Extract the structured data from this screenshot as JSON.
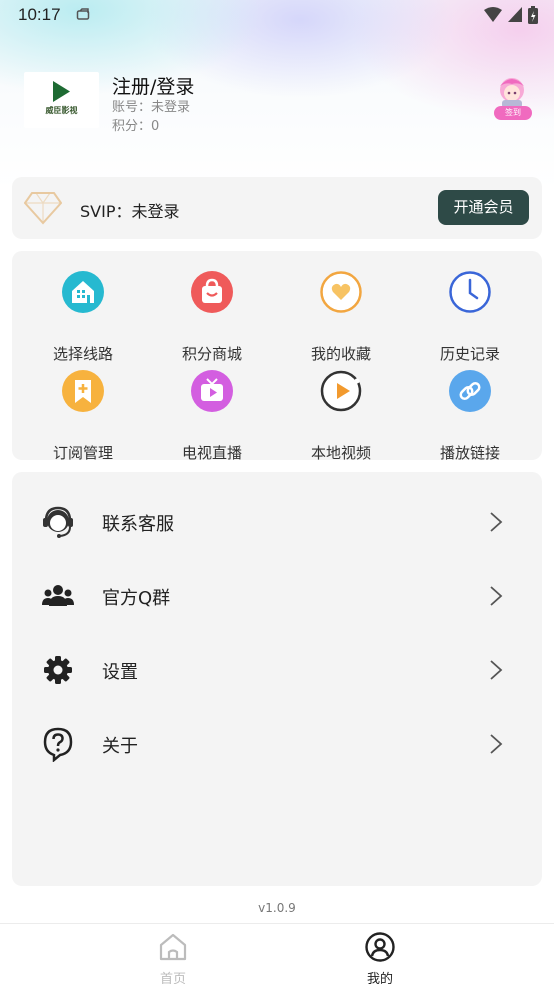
{
  "status_bar": {
    "time": "10:17"
  },
  "profile": {
    "logo_text": "威臣影视",
    "name": "注册/登录",
    "account": "账号：未登录",
    "points": "积分：0",
    "sign_label": "签到"
  },
  "svip": {
    "text": "SVIP：未登录",
    "button": "开通会员"
  },
  "grid": {
    "items": [
      {
        "label": "选择线路",
        "icon": "route-icon",
        "color": "#26b9d0"
      },
      {
        "label": "积分商城",
        "icon": "shop-bag-icon",
        "color": "#ef5a5a"
      },
      {
        "label": "我的收藏",
        "icon": "heart-icon",
        "color": "#f2a640"
      },
      {
        "label": "历史记录",
        "icon": "clock-icon",
        "color": "#3a66d8"
      },
      {
        "label": "订阅管理",
        "icon": "bookmark-plus-icon",
        "color": "#f7b23e"
      },
      {
        "label": "电视直播",
        "icon": "tv-icon",
        "color": "#d35ee0"
      },
      {
        "label": "本地视频",
        "icon": "play-circle-icon",
        "color": "#f29a2e"
      },
      {
        "label": "播放链接",
        "icon": "link-icon",
        "color": "#5aa7ec"
      }
    ]
  },
  "menu": {
    "items": [
      {
        "label": "联系客服",
        "icon": "headset-icon"
      },
      {
        "label": "官方Q群",
        "icon": "group-icon"
      },
      {
        "label": "设置",
        "icon": "gear-icon"
      },
      {
        "label": "关于",
        "icon": "question-icon"
      }
    ]
  },
  "version": "v1.0.9",
  "bottom_nav": {
    "items": [
      {
        "label": "首页",
        "icon": "home-icon",
        "active": false
      },
      {
        "label": "我的",
        "icon": "profile-icon",
        "active": true
      }
    ]
  },
  "colors": {
    "accent": "#2e4a47",
    "card": "#f4f4f4"
  }
}
